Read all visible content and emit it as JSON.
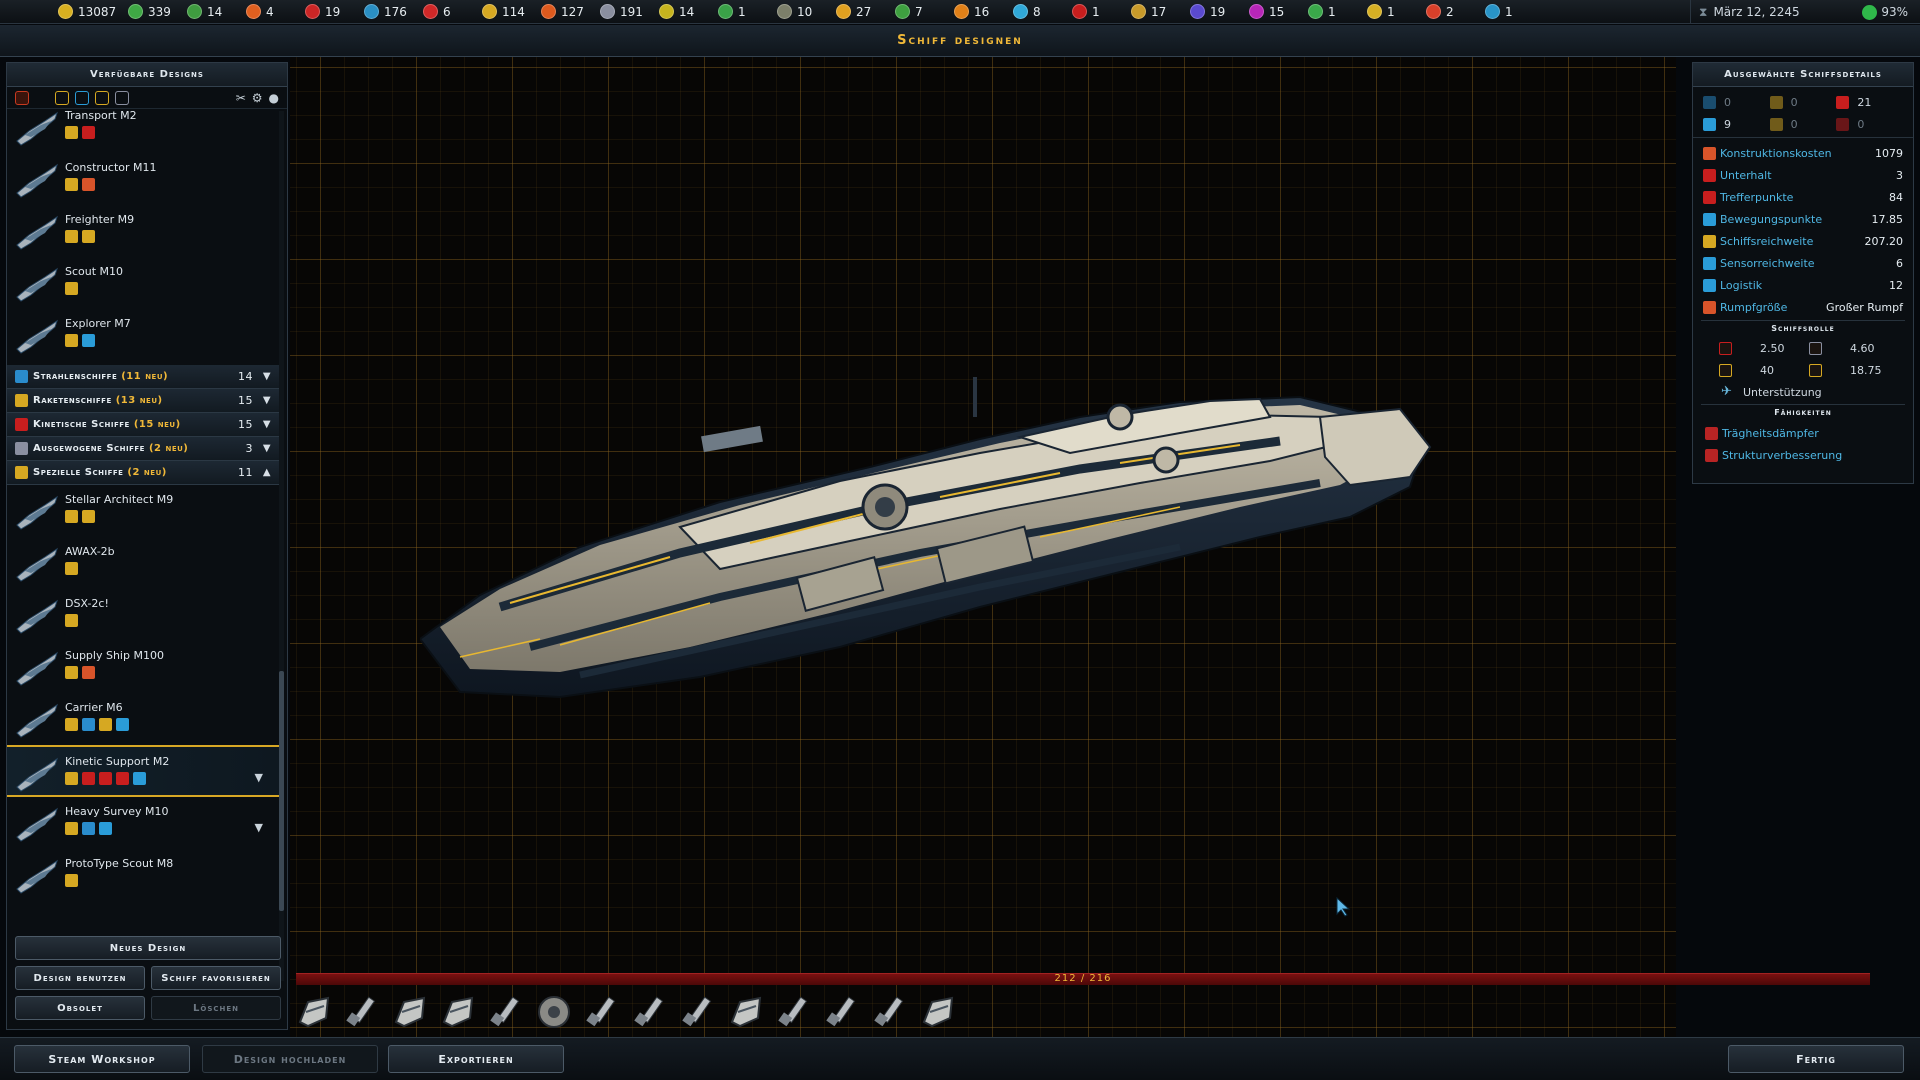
{
  "resources": [
    {
      "value": "13087",
      "color": "#d8b020",
      "icon": "credits-icon"
    },
    {
      "value": "339",
      "color": "#3fa845",
      "icon": "population-icon"
    },
    {
      "value": "14",
      "color": "#3f9c40",
      "icon": "approval-icon"
    },
    {
      "value": "4",
      "color": "#e06020",
      "icon": "manufacturing-icon"
    },
    {
      "value": "19",
      "color": "#cc2626",
      "icon": "military-icon"
    },
    {
      "value": "176",
      "color": "#2a8fc4",
      "icon": "research-icon"
    },
    {
      "value": "6",
      "color": "#d02828",
      "icon": "influence-icon"
    },
    {
      "value": "114",
      "color": "#d6a822",
      "icon": "wealth-icon"
    },
    {
      "value": "127",
      "color": "#de5a1e",
      "icon": "production-icon"
    },
    {
      "value": "191",
      "color": "#8a8fa0",
      "icon": "tech-icon"
    },
    {
      "value": "14",
      "color": "#c6b41e",
      "icon": "happiness-icon"
    },
    {
      "value": "1",
      "color": "#3aa248",
      "icon": "food-icon"
    },
    {
      "value": "10",
      "color": "#7c7f6a",
      "icon": "durantium-icon"
    },
    {
      "value": "27",
      "color": "#e0a020",
      "icon": "antimatter-icon"
    },
    {
      "value": "7",
      "color": "#3ea040",
      "icon": "elerium-icon"
    },
    {
      "value": "16",
      "color": "#e08018",
      "icon": "thulium-icon"
    },
    {
      "value": "8",
      "color": "#30a8d8",
      "icon": "promethion-icon"
    },
    {
      "value": "1",
      "color": "#c81e1e",
      "icon": "resource-red-icon"
    },
    {
      "value": "17",
      "color": "#c89a2a",
      "icon": "resource-gold-icon"
    },
    {
      "value": "19",
      "color": "#5a4ad0",
      "icon": "resource-violet-icon"
    },
    {
      "value": "15",
      "color": "#b826b8",
      "icon": "resource-magenta-icon"
    },
    {
      "value": "1",
      "color": "#3aa84a",
      "icon": "resource-green-icon"
    },
    {
      "value": "1",
      "color": "#d6b024",
      "icon": "resource-yellow-icon"
    },
    {
      "value": "2",
      "color": "#d8402a",
      "icon": "resource-orange-icon"
    },
    {
      "value": "1",
      "color": "#2894c8",
      "icon": "resource-blue-icon"
    }
  ],
  "date": "März 12, 2245",
  "approval": "93%",
  "title": "Schiff designen",
  "left_panel": {
    "header": "Verfügbare Designs",
    "ships_top": [
      {
        "name": "Transport M2",
        "tags": [
          "#d6a822",
          "#c81e1e"
        ]
      },
      {
        "name": "Constructor M11",
        "tags": [
          "#d6a822",
          "#d8542a"
        ]
      },
      {
        "name": "Freighter M9",
        "tags": [
          "#d6a822",
          "#d6a822"
        ]
      },
      {
        "name": "Scout M10",
        "tags": [
          "#d6a822"
        ]
      },
      {
        "name": "Explorer M7",
        "tags": [
          "#d6a822",
          "#2a9cd8"
        ]
      }
    ],
    "categories": [
      {
        "name": "Strahlenschiffe",
        "new": "(11 neu)",
        "count": "14",
        "arrow": "▼",
        "color": "#2a8ccc"
      },
      {
        "name": "Raketenschiffe",
        "new": "(13 neu)",
        "count": "15",
        "arrow": "▼",
        "color": "#d6a822"
      },
      {
        "name": "Kinetische Schiffe",
        "new": "(15 neu)",
        "count": "15",
        "arrow": "▼",
        "color": "#c81e1e"
      },
      {
        "name": "Ausgewogene Schiffe",
        "new": "(2 neu)",
        "count": "3",
        "arrow": "▼",
        "color": "#8a8fa0"
      },
      {
        "name": "Spezielle Schiffe",
        "new": "(2 neu)",
        "count": "11",
        "arrow": "▲",
        "color": "#d6a822"
      }
    ],
    "ships_special": [
      {
        "name": "Stellar Architect M9",
        "tags": [
          "#d6a822",
          "#d6a822"
        ],
        "expand": ""
      },
      {
        "name": "AWAX-2b",
        "tags": [
          "#d6a822"
        ],
        "expand": ""
      },
      {
        "name": "DSX-2c!",
        "tags": [
          "#d6a822"
        ],
        "expand": ""
      },
      {
        "name": "Supply Ship M100",
        "tags": [
          "#d6a822",
          "#d8542a"
        ],
        "expand": ""
      },
      {
        "name": "Carrier M6",
        "tags": [
          "#d6a822",
          "#2a8ccc",
          "#d6a822",
          "#2a9cd8"
        ],
        "expand": ""
      },
      {
        "name": "Kinetic Support M2",
        "tags": [
          "#d6a822",
          "#c81e1e",
          "#c81e1e",
          "#c81e1e",
          "#2a9cd8"
        ],
        "expand": "▼"
      },
      {
        "name": "Heavy Survey M10",
        "tags": [
          "#d6a822",
          "#2a8ccc",
          "#2a9cd8"
        ],
        "expand": "▼"
      },
      {
        "name": "ProtoType Scout M8",
        "tags": [
          "#d6a822"
        ],
        "expand": ""
      }
    ],
    "buttons": {
      "new_design": "Neues Design",
      "use_design": "Design benutzen",
      "favorite": "Schiff favorisieren",
      "obsolete": "Obsolet",
      "delete": "Löschen"
    }
  },
  "right_panel": {
    "header": "Ausgewählte Schiffsdetails",
    "top_stats": [
      {
        "value": "0",
        "color": "#2a8ccc",
        "dim": true,
        "icon": "beam-attack-icon"
      },
      {
        "value": "0",
        "color": "#d6a822",
        "dim": true,
        "icon": "missile-attack-icon"
      },
      {
        "value": "21",
        "color": "#c81e1e",
        "dim": false,
        "icon": "kinetic-attack-icon"
      },
      {
        "value": "9",
        "color": "#2a9cd8",
        "dim": false,
        "icon": "shield-icon"
      },
      {
        "value": "0",
        "color": "#d6a822",
        "dim": true,
        "icon": "point-defense-icon"
      },
      {
        "value": "0",
        "color": "#c81e1e",
        "dim": true,
        "icon": "armor-icon"
      }
    ],
    "stats": [
      {
        "label": "Konstruktionskosten",
        "value": "1079",
        "color": "#d8542a"
      },
      {
        "label": "Unterhalt",
        "value": "3",
        "color": "#c81e1e"
      },
      {
        "label": "Trefferpunkte",
        "value": "84",
        "color": "#c81e1e"
      },
      {
        "label": "Bewegungspunkte",
        "value": "17.85",
        "color": "#2a9cd8"
      },
      {
        "label": "Schiffsreichweite",
        "value": "207.20",
        "color": "#d6a822"
      },
      {
        "label": "Sensorreichweite",
        "value": "6",
        "color": "#2a9cd8"
      },
      {
        "label": "Logistik",
        "value": "12",
        "color": "#2a9cd8"
      },
      {
        "label": "Rumpfgröße",
        "value": "Großer Rumpf",
        "color": "#d8542a"
      }
    ],
    "role_header": "Schiffsrolle",
    "role_values": [
      {
        "value": "2.50",
        "color": "#c81e1e"
      },
      {
        "value": "4.60",
        "color": "#8a8fa0"
      },
      {
        "value": "40",
        "color": "#d6a822"
      },
      {
        "value": "18.75",
        "color": "#d6a822"
      }
    ],
    "role_name": "Unterstützung",
    "abilities_header": "Fähigkeiten",
    "abilities": [
      "Trägheitsdämpfer",
      "Strukturverbesserung"
    ]
  },
  "capacity": "212 / 216",
  "components": [
    "hull-component-icon",
    "kinetic-weapon-icon",
    "armor-plate-icon",
    "shield-module-icon",
    "kinetic-weapon-icon",
    "sensor-dish-icon",
    "kinetic-weapon-icon",
    "kinetic-weapon-icon",
    "kinetic-weapon-icon",
    "armor-plate-icon",
    "kinetic-weapon-icon",
    "kinetic-weapon-icon",
    "kinetic-weapon-icon",
    "engine-component-icon"
  ],
  "bottom": {
    "steam": "Steam Workshop",
    "upload": "Design hochladen",
    "export": "Exportieren",
    "done": "Fertig"
  }
}
